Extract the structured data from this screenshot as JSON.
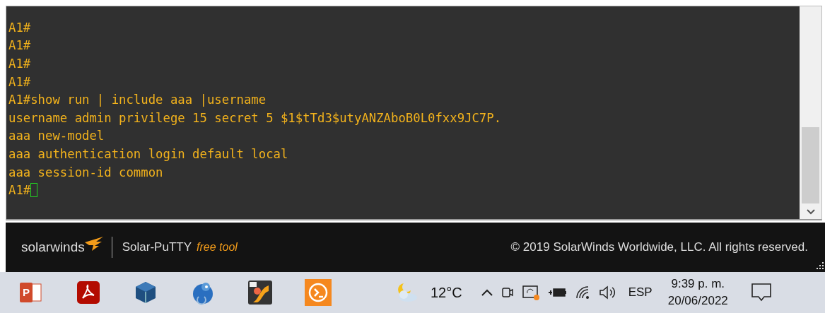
{
  "terminal": {
    "lines": [
      "A1#",
      "A1#",
      "A1#",
      "A1#",
      "A1#show run | include aaa |username",
      "username admin privilege 15 secret 5 $1$tTd3$utyANZAboB0L0fxx9JC7P.",
      "aaa new-model",
      "aaa authentication login default local",
      "aaa session-id common",
      "A1#"
    ],
    "cursor": true
  },
  "footer": {
    "brand": "solarwinds",
    "product": "Solar-PuTTY",
    "tagline": "free tool",
    "copyright": "© 2019 SolarWinds Worldwide, LLC. All rights reserved."
  },
  "taskbar": {
    "apps": [
      {
        "kind": "powerpoint",
        "label": "P"
      },
      {
        "kind": "pdf"
      },
      {
        "kind": "cube"
      },
      {
        "kind": "chameleon"
      },
      {
        "kind": "g4"
      },
      {
        "kind": "terminal"
      }
    ],
    "temperature": "12°C",
    "language": "ESP",
    "time": "9:39 p. m.",
    "date": "20/06/2022"
  }
}
